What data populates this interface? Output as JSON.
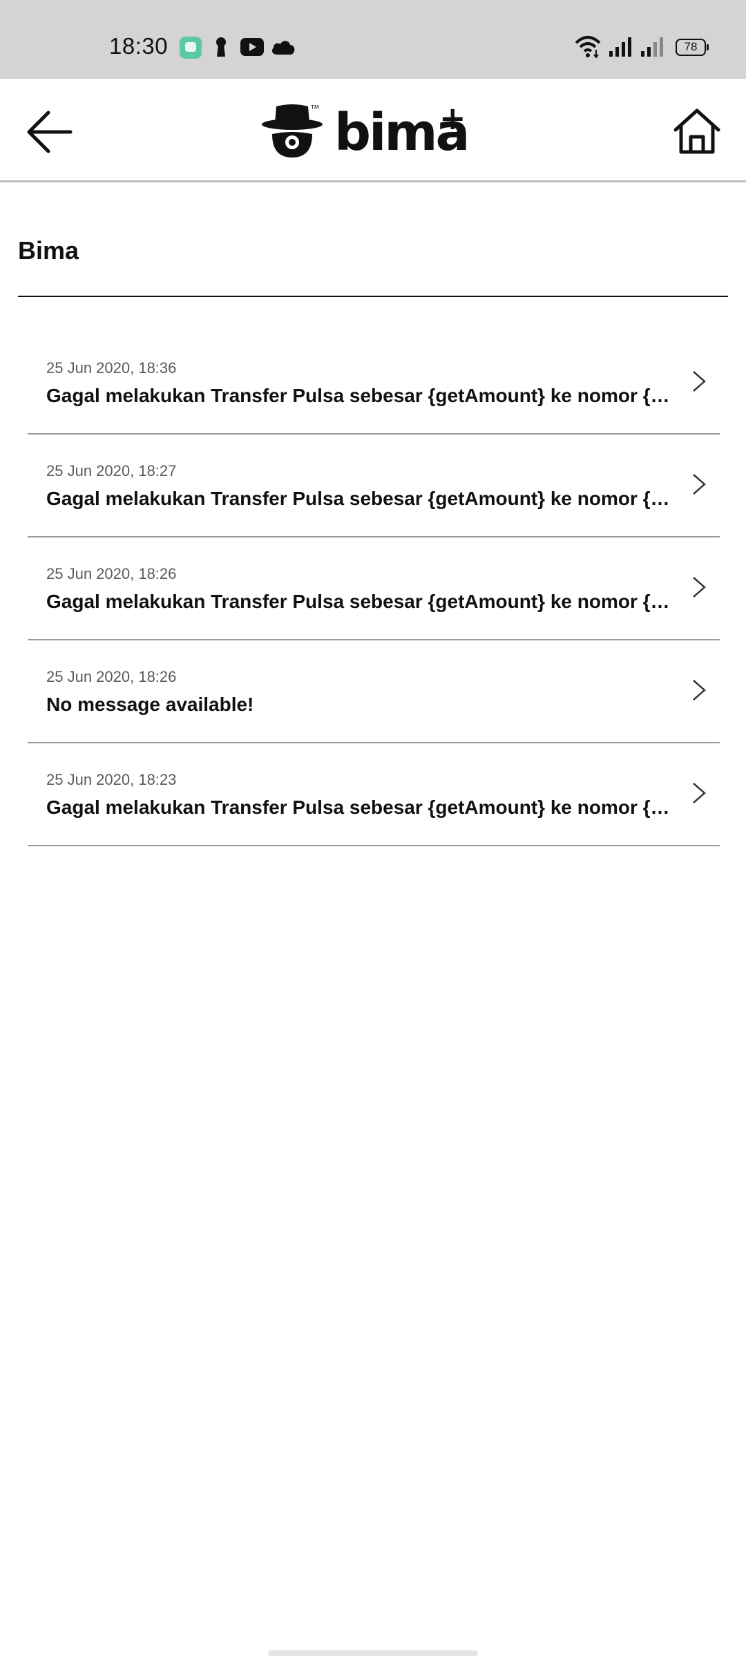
{
  "status_bar": {
    "time": "18:30",
    "battery": "78",
    "icons": [
      "chat-app-icon",
      "keyhole-icon",
      "youtube-icon",
      "cloud-icon",
      "wifi-icon",
      "signal-icon",
      "signal-icon"
    ]
  },
  "app_bar": {
    "back_icon": "arrow-left-icon",
    "logo_text": "bima",
    "logo_plus": "+",
    "home_icon": "home-icon"
  },
  "section": {
    "title": "Bima"
  },
  "notifications": [
    {
      "date": "25 Jun 2020, 18:36",
      "message": "Gagal melakukan Transfer Pulsa sebesar {getAmount} ke nomor {getMsisdn}"
    },
    {
      "date": "25 Jun 2020, 18:27",
      "message": "Gagal melakukan Transfer Pulsa sebesar {getAmount} ke nomor {getMsisdn}"
    },
    {
      "date": "25 Jun 2020, 18:26",
      "message": "Gagal melakukan Transfer Pulsa sebesar {getAmount} ke nomor {getMsisdn}"
    },
    {
      "date": "25 Jun 2020, 18:26",
      "message": "No message available!"
    },
    {
      "date": "25 Jun 2020, 18:23",
      "message": "Gagal melakukan Transfer Pulsa sebesar {getAmount} ke nomor {getMsisdn}"
    }
  ],
  "colors": {
    "status_bar_bg": "#d4d4d4",
    "divider": "#9a9a9a",
    "app_icon_green": "#5cc8a6"
  }
}
